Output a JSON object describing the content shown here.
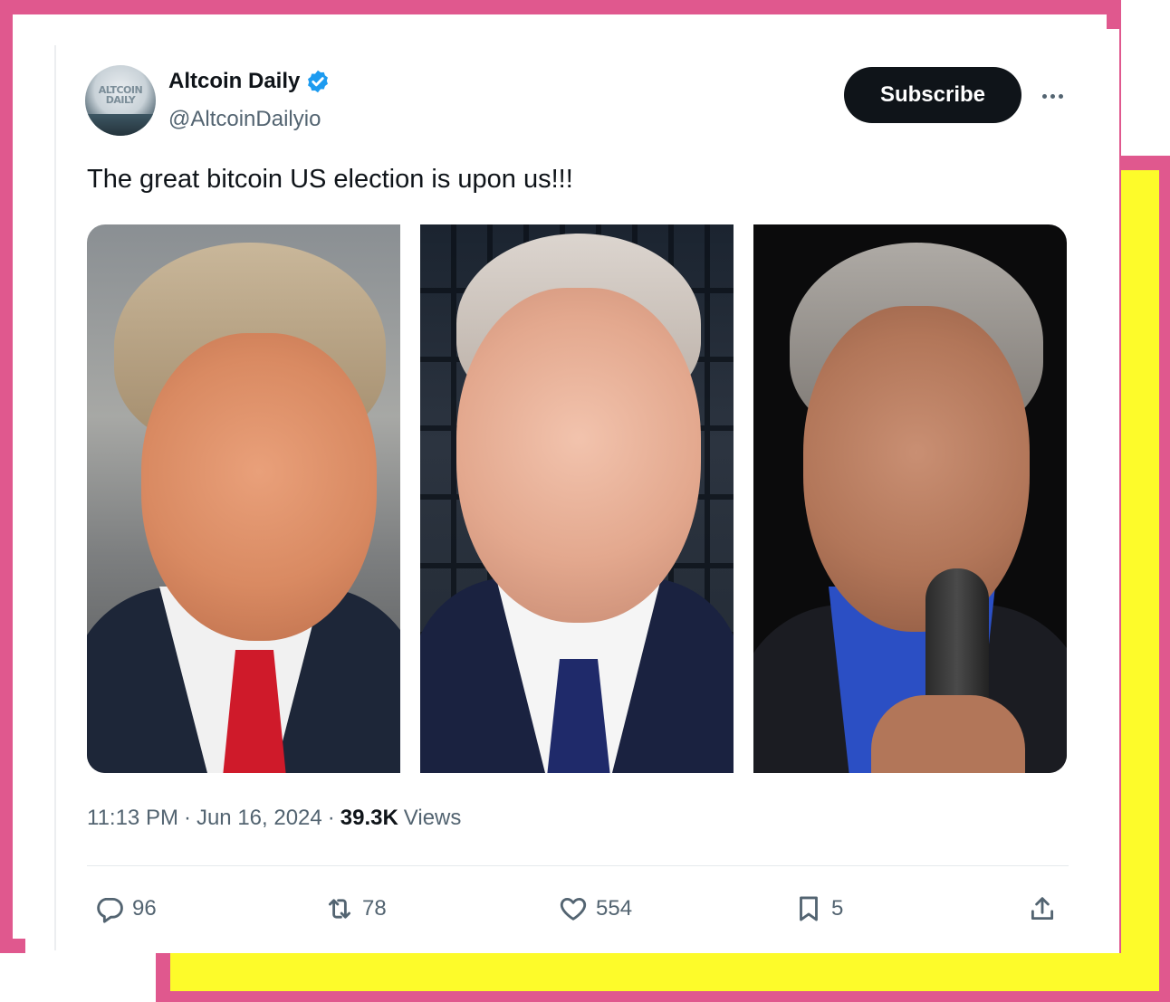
{
  "post": {
    "author": {
      "display_name": "Altcoin Daily",
      "handle": "@AltcoinDailyio",
      "avatar_text": "ALTCOIN DAILY",
      "verified": true
    },
    "subscribe_label": "Subscribe",
    "more_icon": "more-horizontal-icon",
    "text": "The great bitcoin US election is upon us!!!",
    "media": [
      {
        "type": "photo"
      },
      {
        "type": "photo"
      },
      {
        "type": "photo"
      }
    ],
    "meta": {
      "time": "11:13 PM",
      "separator": "·",
      "date": "Jun 16, 2024",
      "views_count": "39.3K",
      "views_label": "Views"
    },
    "actions": {
      "replies": "96",
      "reposts": "78",
      "likes": "554",
      "bookmarks": "5"
    }
  },
  "colors": {
    "frame_pink": "#e0588e",
    "frame_yellow": "#fdfb2a",
    "verified_blue": "#1d9bf0",
    "text_primary": "#0f1419",
    "text_secondary": "#536471"
  }
}
